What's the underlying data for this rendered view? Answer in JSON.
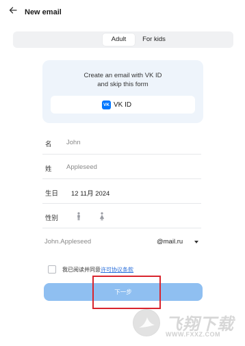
{
  "header": {
    "title": "New email",
    "back_icon": "arrow-left-icon"
  },
  "tabs": [
    {
      "label": "Adult",
      "active": true
    },
    {
      "label": "For kids",
      "active": false
    }
  ],
  "vk_card": {
    "line1": "Create an email with VK ID",
    "line2": "and skip this form",
    "button_label": "VK ID",
    "logo_text": "VK",
    "logo_color": "#0077ff"
  },
  "form": {
    "first_name": {
      "label": "名",
      "placeholder": "John"
    },
    "last_name": {
      "label": "姓",
      "placeholder": "Appleseed"
    },
    "birthday": {
      "label": "生日",
      "value": "12 11月 2024"
    },
    "gender": {
      "label": "性别",
      "options": [
        "male-icon",
        "female-icon"
      ]
    },
    "email": {
      "placeholder": "John.Appleseed",
      "domain": "@mail.ru"
    }
  },
  "agreement": {
    "text": "我已阅读并同意",
    "link": "许可协议条款"
  },
  "next_button": {
    "label": "下一步",
    "color": "#8fbff1"
  },
  "annotation_color": "#d9232c",
  "watermark": {
    "cn": "飞翔下载",
    "url": "WWW.FXXZ.COM"
  }
}
